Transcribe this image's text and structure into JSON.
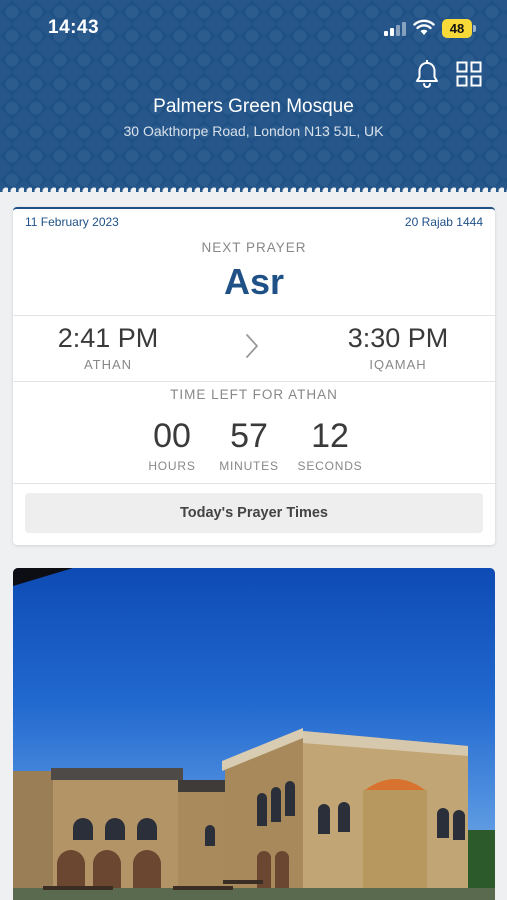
{
  "status_bar": {
    "time": "14:43",
    "battery": "48"
  },
  "header": {
    "mosque_name": "Palmers Green Mosque",
    "address": "30 Oakthorpe Road, London N13 5JL, UK"
  },
  "prayer_card": {
    "date_gregorian": "11 February 2023",
    "date_hijri": "20 Rajab 1444",
    "next_prayer_label": "NEXT PRAYER",
    "next_prayer_name": "Asr",
    "athan_time": "2:41 PM",
    "athan_label": "ATHAN",
    "iqamah_time": "3:30 PM",
    "iqamah_label": "IQAMAH",
    "time_left_label": "TIME LEFT FOR ATHAN",
    "countdown": {
      "hours": "00",
      "hours_label": "HOURS",
      "minutes": "57",
      "minutes_label": "MINUTES",
      "seconds": "12",
      "seconds_label": "SECONDS"
    },
    "button_label": "Today's Prayer Times"
  },
  "icons": [
    "signal-icon",
    "wifi-icon",
    "battery-icon",
    "bell-icon",
    "grid-icon",
    "chevron-right-icon"
  ],
  "colors": {
    "brand_blue": "#1f5186",
    "battery_yellow": "#f7d937",
    "page_bg": "#eef0f2"
  }
}
